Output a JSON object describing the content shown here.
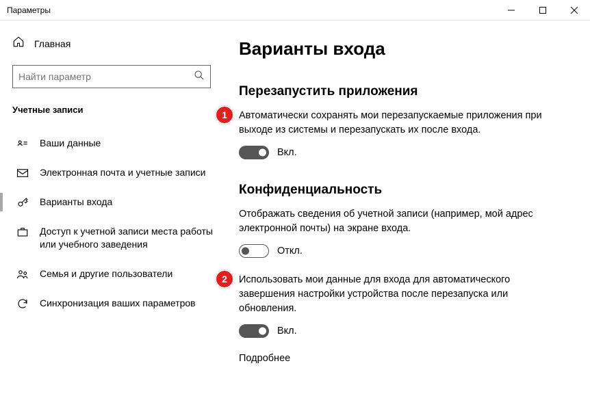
{
  "window": {
    "title": "Параметры"
  },
  "sidebar": {
    "home_label": "Главная",
    "search_placeholder": "Найти параметр",
    "heading": "Учетные записи",
    "items": [
      {
        "label": "Ваши данные"
      },
      {
        "label": "Электронная почта и учетные записи"
      },
      {
        "label": "Варианты входа"
      },
      {
        "label": "Доступ к учетной записи места работы или учебного заведения"
      },
      {
        "label": "Семья и другие пользователи"
      },
      {
        "label": "Синхронизация ваших параметров"
      }
    ]
  },
  "content": {
    "title": "Варианты входа",
    "section1": {
      "heading": "Перезапустить приложения",
      "item1": {
        "desc": "Автоматически сохранять мои перезапускаемые приложения при выходе из системы и перезапускать их после входа.",
        "toggle_label": "Вкл."
      }
    },
    "section2": {
      "heading": "Конфиденциальность",
      "item1": {
        "desc": "Отображать сведения об учетной записи (например, мой адрес электронной почты) на экране входа.",
        "toggle_label": "Откл."
      },
      "item2": {
        "desc": "Использовать мои данные для входа для автоматического завершения настройки устройства после перезапуска или обновления.",
        "toggle_label": "Вкл."
      },
      "more_link": "Подробнее"
    }
  },
  "annotations": {
    "one": "1",
    "two": "2"
  }
}
